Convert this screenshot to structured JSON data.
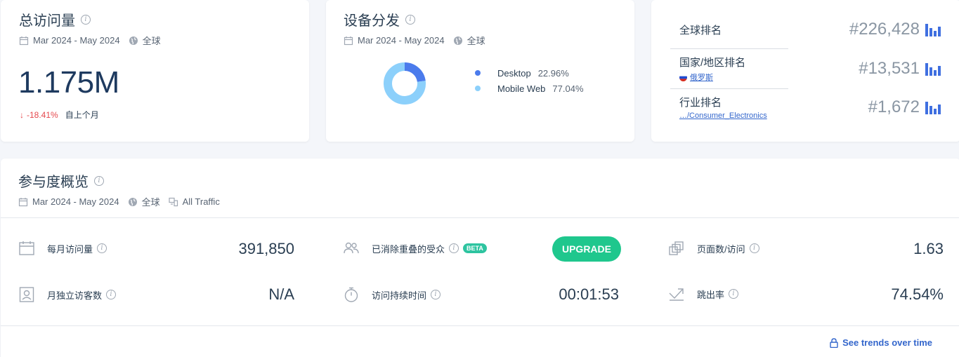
{
  "visits_card": {
    "title": "总访问量",
    "date_range": "Mar 2024 - May 2024",
    "region": "全球",
    "value": "1.175M",
    "change": "-18.41%",
    "compare": "自上个月"
  },
  "device_card": {
    "title": "设备分发",
    "date_range": "Mar 2024 - May 2024",
    "region": "全球",
    "chart_data": {
      "type": "pie",
      "categories": [
        "Desktop",
        "Mobile Web"
      ],
      "values": [
        22.96,
        77.04
      ],
      "colors": [
        "#4b7bec",
        "#8cd0fb"
      ]
    },
    "legend": [
      {
        "label": "Desktop",
        "value": "22.96%"
      },
      {
        "label": "Mobile Web",
        "value": "77.04%"
      }
    ]
  },
  "rank_card": {
    "global": {
      "label": "全球排名",
      "value": "#226,428"
    },
    "country": {
      "label": "国家/地区排名",
      "link": "俄罗斯",
      "value": "#13,531"
    },
    "industry": {
      "label": "行业排名",
      "link": "…/Consumer_Electronics",
      "value": "#1,672"
    }
  },
  "engagement": {
    "title": "参与度概览",
    "date_range": "Mar 2024 - May 2024",
    "region": "全球",
    "traffic": "All Traffic",
    "metrics": {
      "monthly_visits": {
        "label": "每月访问量",
        "value": "391,850"
      },
      "dedup_audience": {
        "label": "已消除重叠的受众",
        "badge": "BETA",
        "button": "UPGRADE"
      },
      "pages_per_visit": {
        "label": "页面数/访问",
        "value": "1.63"
      },
      "unique_visitors": {
        "label": "月独立访客数",
        "value": "N/A"
      },
      "visit_duration": {
        "label": "访问持续时间",
        "value": "00:01:53"
      },
      "bounce_rate": {
        "label": "跳出率",
        "value": "74.54%"
      }
    },
    "trend_link": "See trends over time"
  }
}
